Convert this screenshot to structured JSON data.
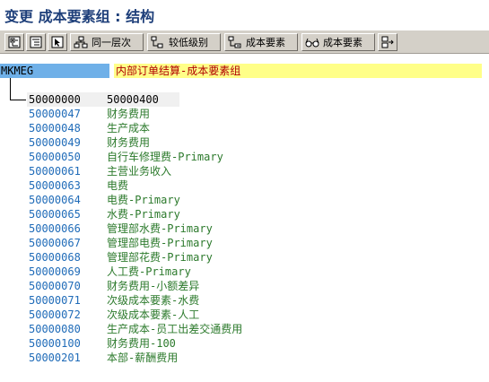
{
  "window": {
    "title": "变更 成本要素组 : 结构"
  },
  "toolbar": {
    "buttons": [
      {
        "icon": "expand-all-icon",
        "label": ""
      },
      {
        "icon": "collapse-icon",
        "label": ""
      },
      {
        "icon": "select-icon",
        "label": ""
      },
      {
        "icon": "hierarchy-icon",
        "label": "同一层次"
      },
      {
        "icon": "hierarchy-icon",
        "label": "较低级别"
      },
      {
        "icon": "hierarchy-icon",
        "label": "成本要素"
      },
      {
        "icon": "glasses-icon",
        "label": "成本要素"
      },
      {
        "icon": "move-icon",
        "label": ""
      }
    ]
  },
  "tree": {
    "root": {
      "id": "MKMEG",
      "description": "内部订单结算-成本要素组"
    },
    "subnode": {
      "id": "50000000",
      "description": "50000400"
    },
    "items": [
      {
        "id": "50000047",
        "description": "财务费用"
      },
      {
        "id": "50000048",
        "description": "生产成本"
      },
      {
        "id": "50000049",
        "description": "财务费用"
      },
      {
        "id": "50000050",
        "description": "自行车修理费-Primary"
      },
      {
        "id": "50000061",
        "description": "主营业务收入"
      },
      {
        "id": "50000063",
        "description": "电费"
      },
      {
        "id": "50000064",
        "description": "电费-Primary"
      },
      {
        "id": "50000065",
        "description": "水费-Primary"
      },
      {
        "id": "50000066",
        "description": "管理部水费-Primary"
      },
      {
        "id": "50000067",
        "description": "管理部电费-Primary"
      },
      {
        "id": "50000068",
        "description": "管理部花费-Primary"
      },
      {
        "id": "50000069",
        "description": "人工费-Primary"
      },
      {
        "id": "50000070",
        "description": "财务费用-小额差异"
      },
      {
        "id": "50000071",
        "description": "次级成本要素-水费"
      },
      {
        "id": "50000072",
        "description": "次级成本要素-人工"
      },
      {
        "id": "50000080",
        "description": "生产成本-员工出差交通费用"
      },
      {
        "id": "50000100",
        "description": "财务费用-100"
      },
      {
        "id": "50000201",
        "description": "本部-薪酬费用"
      }
    ]
  }
}
